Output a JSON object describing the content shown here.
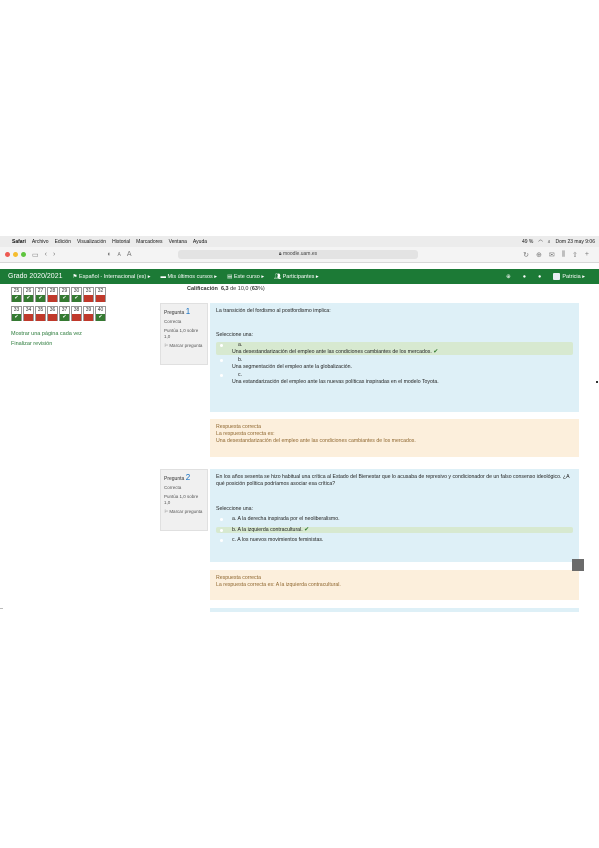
{
  "menubar": {
    "apple_icon": "apple-icon",
    "items": [
      "Safari",
      "Archivo",
      "Edición",
      "Visualización",
      "Historial",
      "Marcadores",
      "Ventana",
      "Ayuda"
    ],
    "battery": "49 %",
    "datetime": "Dom 23 may  9:06"
  },
  "browser": {
    "url": "moodle.uam.es",
    "zoom_small": "A",
    "zoom_large": "A"
  },
  "navbar": {
    "brand": "Grado 2020/2021",
    "items": [
      "Español - Internacional (es) ▸",
      "Mis últimos cursos ▸",
      "Este curso ▸",
      "Participantes ▸"
    ],
    "user": "Patricia ▸"
  },
  "quiz_nav": {
    "rows": [
      {
        "nums": [
          "25",
          "26",
          "27",
          "28",
          "29",
          "30",
          "31",
          "32"
        ],
        "states": [
          "ok",
          "ok",
          "ok",
          "bad",
          "ok",
          "ok",
          "bad",
          "bad"
        ]
      },
      {
        "nums": [
          "33",
          "34",
          "35",
          "36",
          "37",
          "38",
          "39",
          "40"
        ],
        "states": [
          "ok",
          "bad",
          "bad",
          "bad",
          "ok",
          "bad",
          "bad",
          "ok"
        ]
      }
    ],
    "show_one_page": "Mostrar una página cada vez",
    "finish_review": "Finalizar revisión"
  },
  "summary": {
    "label": "Calificación",
    "grade": "6,3",
    "of": "de 10,0 (",
    "percent": "63",
    "close": "%)"
  },
  "questions": [
    {
      "label": "Pregunta",
      "number": "1",
      "status": "Correcta",
      "score": "Puntúa 1,0 sobre 1,0",
      "flag": "Marcar pregunta",
      "text": "La transición del fordismo al postfordismo implica:",
      "select_label": "Seleccione una:",
      "options": [
        {
          "letter": "a.",
          "text": "Una desestandarización del empleo ante las condiciones cambiantes de los mercados.",
          "correct": true
        },
        {
          "letter": "b.",
          "text": "Una segmentación del empleo ante la globalización.",
          "correct": false
        },
        {
          "letter": "c.",
          "text": "Una estandarización del empleo ante las nuevas políticas inspiradas en el modelo Toyota.",
          "correct": false
        }
      ],
      "feedback_title": "Respuesta correcta",
      "feedback_label": "La respuesta correcta es:",
      "feedback_answer": "Una desestandarización del empleo ante las condiciones cambiantes de los mercados."
    },
    {
      "label": "Pregunta",
      "number": "2",
      "status": "Correcta",
      "score": "Puntúa 1,0 sobre 1,0",
      "flag": "Marcar pregunta",
      "text": "En los años sesenta se hizo habitual una crítica al Estado del Bienestar que lo acusaba de represivo y condicionador de un falso consenso ideológico. ¿A qué posición política podríamos asociar esa crítica?",
      "select_label": "Seleccione una:",
      "options": [
        {
          "letter": "a.",
          "text": "A la derecha inspirada por el neoliberalismo.",
          "correct": false
        },
        {
          "letter": "b.",
          "text": "A la izquierda contracultural.",
          "correct": true
        },
        {
          "letter": "c.",
          "text": "A los nuevos movimientos feministas.",
          "correct": false
        }
      ],
      "feedback_title": "Respuesta correcta",
      "feedback_answer": "La respuesta correcta es: A la izquierda contracultural."
    }
  ],
  "colors": {
    "navbar": "#1c7a36",
    "correct_mark": "#357a32",
    "wrong_mark": "#c0392b",
    "question_bg": "#def0f7",
    "feedback_bg": "#fcefdc"
  }
}
